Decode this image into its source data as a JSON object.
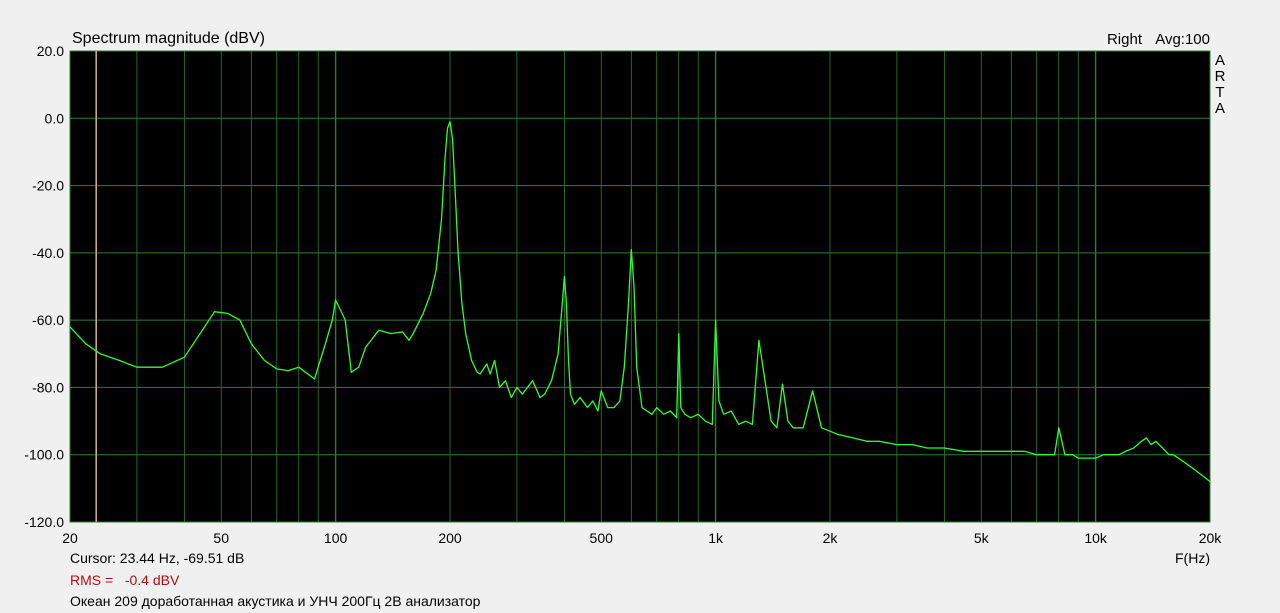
{
  "chart_data": {
    "type": "line",
    "title": "Spectrum magnitude (dBV)",
    "channel_label": "Right",
    "avg_label": "Avg:100",
    "brand_letters": [
      "A",
      "R",
      "T",
      "A"
    ],
    "xlabel": "F(Hz)",
    "x_scale": "log",
    "xlim": [
      20,
      20000
    ],
    "ylim": [
      -120,
      20
    ],
    "y_ticks": [
      20,
      0,
      -20,
      -40,
      -60,
      -80,
      -100,
      -120
    ],
    "y_tick_labels": [
      "20.0",
      "0.0",
      "-20.0",
      "-40.0",
      "-60.0",
      "-80.0",
      "-100.0",
      "-120.0"
    ],
    "x_tick_values": [
      20,
      50,
      100,
      200,
      500,
      1000,
      2000,
      5000,
      10000,
      20000
    ],
    "x_tick_labels": [
      "20",
      "50",
      "100",
      "200",
      "500",
      "1k",
      "2k",
      "5k",
      "10k",
      "20k"
    ],
    "grid": true,
    "cursor_freq_hz": 23.44,
    "series": [
      {
        "x": [
          20,
          22,
          24,
          27,
          30,
          35,
          40,
          44,
          48,
          52,
          56,
          60,
          65,
          70,
          75,
          80,
          88,
          94,
          98,
          100,
          103,
          106,
          110,
          115,
          120,
          130,
          140,
          150,
          156,
          160,
          170,
          178,
          184,
          190,
          194,
          197,
          200,
          203,
          206,
          210,
          215,
          220,
          228,
          236,
          240,
          250,
          255,
          262,
          270,
          280,
          290,
          300,
          310,
          330,
          345,
          355,
          370,
          385,
          395,
          400,
          405,
          410,
          415,
          425,
          440,
          460,
          475,
          490,
          500,
          520,
          540,
          560,
          575,
          590,
          600,
          610,
          620,
          640,
          660,
          680,
          700,
          730,
          760,
          790,
          800,
          810,
          830,
          860,
          900,
          940,
          980,
          1000,
          1020,
          1050,
          1100,
          1150,
          1200,
          1250,
          1300,
          1400,
          1450,
          1500,
          1550,
          1600,
          1700,
          1800,
          1900,
          2000,
          2100,
          2300,
          2500,
          2700,
          3000,
          3300,
          3600,
          4000,
          4500,
          5000,
          5500,
          6000,
          6500,
          7000,
          7500,
          7800,
          8000,
          8300,
          8700,
          9000,
          9500,
          10000,
          10500,
          11000,
          11500,
          12000,
          12600,
          13200,
          13600,
          14000,
          14400,
          15000,
          15600,
          16000,
          16500,
          17000,
          18000,
          19000,
          20000
        ],
        "y": [
          -62,
          -67,
          -70,
          -72,
          -74,
          -74,
          -71,
          -64,
          -57.5,
          -58,
          -60,
          -67,
          -72,
          -74.5,
          -75,
          -74,
          -77.5,
          -67,
          -60,
          -54,
          -57,
          -60,
          -75.5,
          -74,
          -68,
          -63,
          -64,
          -63.5,
          -66,
          -64,
          -58,
          -52,
          -45,
          -30,
          -12,
          -3,
          -1,
          -6,
          -20,
          -40,
          -55,
          -64,
          -72,
          -75.5,
          -76,
          -73,
          -76,
          -72,
          -80,
          -78,
          -83,
          -80,
          -82,
          -78,
          -83,
          -82,
          -78,
          -70,
          -55,
          -47,
          -55,
          -72,
          -82,
          -85,
          -83,
          -86,
          -84,
          -87,
          -81,
          -86,
          -86,
          -84,
          -74,
          -55,
          -39,
          -50,
          -74,
          -86,
          -87,
          -88,
          -86,
          -88,
          -87,
          -89,
          -64,
          -86,
          -88,
          -89,
          -88,
          -90,
          -91,
          -60,
          -84,
          -88,
          -87,
          -91,
          -90,
          -91,
          -66,
          -90,
          -92,
          -79,
          -90,
          -92,
          -92,
          -81,
          -92,
          -93,
          -94,
          -95,
          -96,
          -96,
          -97,
          -97,
          -98,
          -98,
          -99,
          -99,
          -99,
          -99,
          -99,
          -100,
          -100,
          -100,
          -92,
          -100,
          -100,
          -101,
          -101,
          -101,
          -100,
          -100,
          -100,
          -99,
          -98,
          -96,
          -95,
          -97,
          -96,
          -98,
          -100,
          -100,
          -101,
          -102,
          -104,
          -106,
          -108
        ]
      }
    ]
  },
  "footer": {
    "cursor_text": "Cursor: 23.44 Hz, -69.51 dB",
    "rms_text": "RMS =   -0.4 dBV",
    "description": "Океан 209 доработанная акустика и УНЧ 200Гц 2В анализатор"
  },
  "colors": {
    "background": "#f0f0f0",
    "plot_background": "#000000",
    "grid": "#2e7d32",
    "trace": "#2bff2b",
    "cursor": "#d8b487",
    "rms_text": "#b01010"
  }
}
